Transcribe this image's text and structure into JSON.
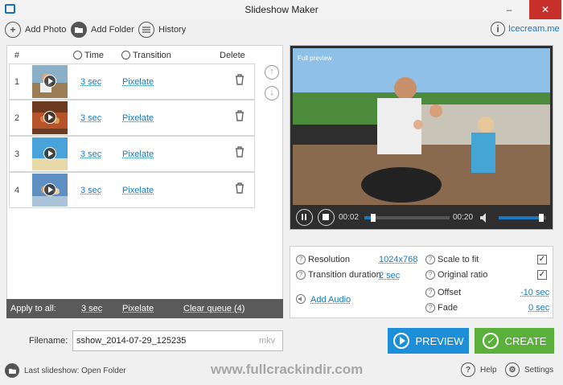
{
  "window": {
    "title": "Slideshow Maker",
    "minimize": "‒",
    "close": "✕"
  },
  "toolbar": {
    "add_photo": "Add Photo",
    "add_folder": "Add Folder",
    "history": "History"
  },
  "brand": {
    "name": "Icecream.me"
  },
  "queue": {
    "headers": {
      "num": "#",
      "time": "Time",
      "transition": "Transition",
      "delete": "Delete"
    },
    "rows": [
      {
        "num": "1",
        "time": "3 sec",
        "transition": "Pixelate"
      },
      {
        "num": "2",
        "time": "3 sec",
        "transition": "Pixelate"
      },
      {
        "num": "3",
        "time": "3 sec",
        "transition": "Pixelate"
      },
      {
        "num": "4",
        "time": "3 sec",
        "transition": "Pixelate"
      }
    ],
    "apply_all": {
      "label": "Apply to all:",
      "time": "3 sec",
      "transition": "Pixelate",
      "clear": "Clear queue (4)"
    }
  },
  "preview": {
    "label": "Full preview",
    "current_time": "00:02",
    "total_time": "00:20",
    "progress": 0.1,
    "volume": 0.9
  },
  "settings": {
    "resolution_label": "Resolution",
    "resolution_value": "1024x768",
    "transition_duration_label": "Transition duration",
    "transition_duration_value": "2 sec",
    "add_audio": "Add Audio",
    "scale_to_fit_label": "Scale to fit",
    "scale_to_fit_checked": "✓",
    "original_ratio_label": "Original ratio",
    "original_ratio_checked": "✓",
    "offset_label": "Offset",
    "offset_value": "-10 sec",
    "fade_label": "Fade",
    "fade_value": "0 sec"
  },
  "filename": {
    "label": "Filename:",
    "value": "sshow_2014-07-29_125235",
    "extension": "mkv"
  },
  "actions": {
    "preview": "PREVIEW",
    "create": "CREATE"
  },
  "footer": {
    "last_slideshow": "Last slideshow: Open Folder",
    "help": "Help",
    "settings": "Settings"
  },
  "watermark": "www.fullcrackindir.com",
  "colors": {
    "accent_blue": "#1d8ed8",
    "create_green": "#5ab03a",
    "link_blue": "#1a78c2"
  }
}
